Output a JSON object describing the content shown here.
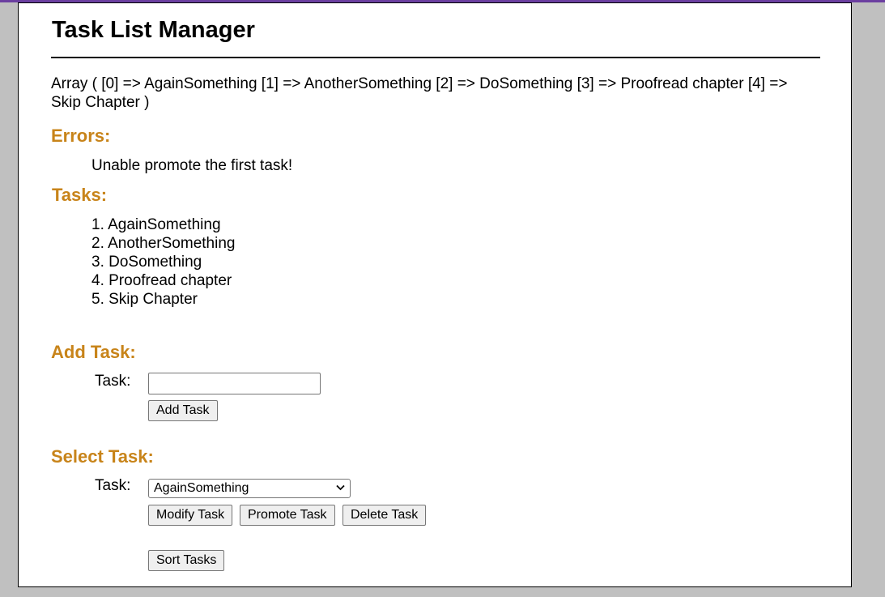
{
  "header": {
    "title": "Task List Manager"
  },
  "debug": {
    "array_dump": "Array ( [0] => AgainSomething [1] => AnotherSomething [2] => DoSomething [3] => Proofread chapter [4] => Skip Chapter )"
  },
  "errors": {
    "heading": "Errors:",
    "message": "Unable promote the first task!"
  },
  "tasks": {
    "heading": "Tasks:",
    "items": [
      "1. AgainSomething",
      "2. AnotherSomething",
      "3. DoSomething",
      "4. Proofread chapter",
      "5. Skip Chapter"
    ]
  },
  "add_task": {
    "heading": "Add Task:",
    "label": "Task:",
    "input_value": "",
    "button_label": "Add Task"
  },
  "select_task": {
    "heading": "Select Task:",
    "label": "Task:",
    "selected": "AgainSomething",
    "buttons": {
      "modify": "Modify Task",
      "promote": "Promote Task",
      "delete": "Delete Task",
      "sort": "Sort Tasks"
    }
  },
  "colors": {
    "heading": "#c8841a",
    "background": "#c0c0c0",
    "accent": "#6b3fa0"
  },
  "icons": {
    "select_arrow": "chevron-down-icon"
  }
}
